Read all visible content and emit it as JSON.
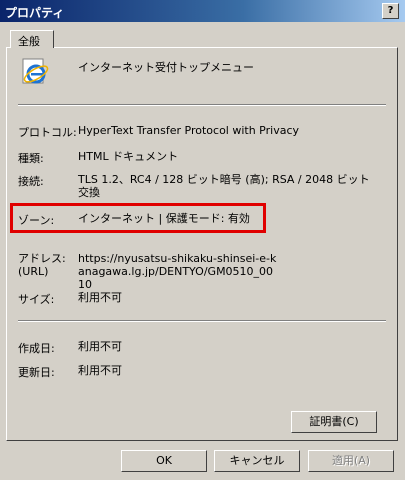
{
  "window": {
    "title": "プロパティ",
    "help_label": "?"
  },
  "tabs": [
    {
      "label": "全般"
    }
  ],
  "page": {
    "name": "インターネット受付トップメニュー"
  },
  "fields": [
    {
      "label": "プロトコル:",
      "value": "HyperText Transfer Protocol with Privacy"
    },
    {
      "label": "種類:",
      "value": "HTML ドキュメント"
    },
    {
      "label": "接続:",
      "value": "TLS 1.2、RC4 / 128 ビット暗号 (高); RSA / 2048 ビット交換"
    },
    {
      "label": "ゾーン:",
      "value": "インターネット | 保護モード: 有効"
    },
    {
      "label": "アドレス:\n(URL)",
      "value": "https://nyusatsu-shikaku-shinsei-e-kanagawa.lg.jp/DENTYO/GM0510_0010"
    },
    {
      "label": "サイズ:",
      "value": "利用不可"
    },
    {
      "label": "作成日:",
      "value": "利用不可"
    },
    {
      "label": "更新日:",
      "value": "利用不可"
    }
  ],
  "buttons": {
    "certificate": "証明書(C)",
    "ok": "OK",
    "cancel": "キャンセル",
    "apply": "適用(A)"
  },
  "colors": {
    "highlight": "#e00000",
    "titlebar": "#0a246a"
  },
  "icons": {
    "page_icon": "internet-explorer-icon"
  }
}
